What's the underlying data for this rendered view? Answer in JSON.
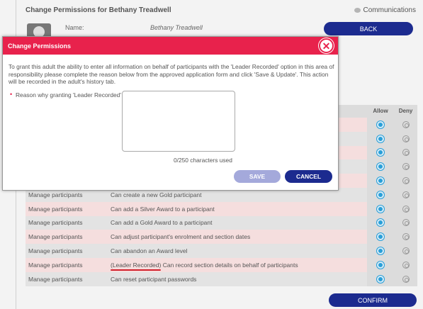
{
  "page": {
    "title": "Change Permissions for Bethany Treadwell",
    "communications": "Communications",
    "name_label": "Name:",
    "name_value": "Bethany Treadwell",
    "back": "BACK",
    "confirm": "CONFIRM"
  },
  "table": {
    "col_allow": "Allow",
    "col_deny": "Deny",
    "rows": [
      {
        "area": "",
        "permission": "",
        "style": "pink",
        "allow": true
      },
      {
        "area": "",
        "permission": "",
        "style": "grey",
        "allow": true
      },
      {
        "area": "",
        "permission": "",
        "style": "pink",
        "allow": true
      },
      {
        "area": "",
        "permission": "",
        "style": "grey",
        "allow": true
      },
      {
        "area": "",
        "permission": "",
        "style": "pink",
        "allow": true
      },
      {
        "area": "Manage participants",
        "permission": "Can create a new Gold participant",
        "style": "grey",
        "allow": true
      },
      {
        "area": "Manage participants",
        "permission": "Can add a Silver Award to a participant",
        "style": "pink",
        "allow": true
      },
      {
        "area": "Manage participants",
        "permission": "Can add a Gold Award to a participant",
        "style": "grey",
        "allow": true
      },
      {
        "area": "Manage participants",
        "permission": "Can adjust participant's enrolment and section dates",
        "style": "pink",
        "allow": true
      },
      {
        "area": "Manage participants",
        "permission": "Can abandon an Award level",
        "style": "grey",
        "allow": true
      },
      {
        "area": "Manage participants",
        "tag": "(Leader Recorded)",
        "permission": " Can record section details on behalf of participants",
        "style": "pink",
        "allow": true
      },
      {
        "area": "Manage participants",
        "permission": "Can reset participant passwords",
        "style": "grey",
        "allow": true
      }
    ]
  },
  "modal": {
    "title": "Change Permissions",
    "text": "To grant this adult the ability to enter all information on behalf of participants with the 'Leader Recorded' option in this area of responsibility please complete the reason below from the approved application form and click 'Save & Update'. This action will be recorded in the adult's history tab.",
    "required_marker": "•",
    "reason_label": "Reason why granting 'Leader Recorded'",
    "reason_value": "",
    "char_count": "0/250 characters used",
    "save": "SAVE",
    "cancel": "CANCEL"
  },
  "colors": {
    "accent": "#e8224c",
    "primary": "#1c2b8f",
    "radio": "#2a9fd8",
    "underline": "#d21f2b"
  }
}
